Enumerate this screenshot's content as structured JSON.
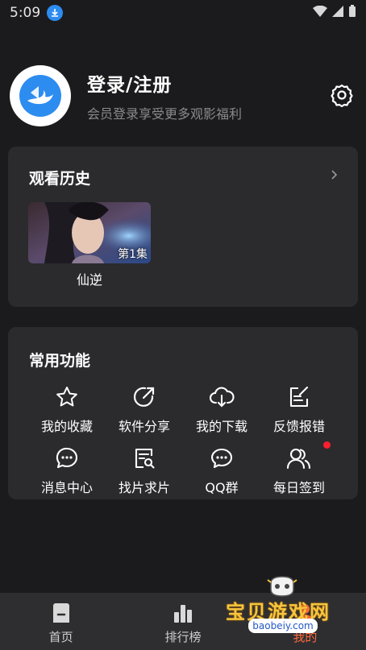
{
  "status_bar": {
    "time": "5:09"
  },
  "profile": {
    "title": "登录/注册",
    "subtitle": "会员登录享受更多观影福利"
  },
  "history": {
    "title": "观看历史",
    "items": [
      {
        "name": "仙逆",
        "episode": "第1集"
      }
    ]
  },
  "functions": {
    "title": "常用功能",
    "items": [
      {
        "label": "我的收藏",
        "icon": "star-icon"
      },
      {
        "label": "软件分享",
        "icon": "share-icon"
      },
      {
        "label": "我的下载",
        "icon": "cloud-download-icon"
      },
      {
        "label": "反馈报错",
        "icon": "edit-icon"
      },
      {
        "label": "消息中心",
        "icon": "chat-icon"
      },
      {
        "label": "找片求片",
        "icon": "search-document-icon"
      },
      {
        "label": "QQ群",
        "icon": "chat-bubble-icon"
      },
      {
        "label": "每日签到",
        "icon": "users-icon"
      }
    ]
  },
  "tabs": [
    {
      "label": "首页",
      "icon": "home-icon"
    },
    {
      "label": "排行榜",
      "icon": "ranking-icon"
    },
    {
      "label": "我的",
      "icon": "user-icon"
    }
  ],
  "watermark": {
    "text": "宝贝游戏网",
    "url": "baobeiy.com"
  },
  "colors": {
    "background": "#1b1b1d",
    "card": "#2b2b2e",
    "accent_blue": "#2d8cf0",
    "notification_dot": "#ff1e2d"
  }
}
